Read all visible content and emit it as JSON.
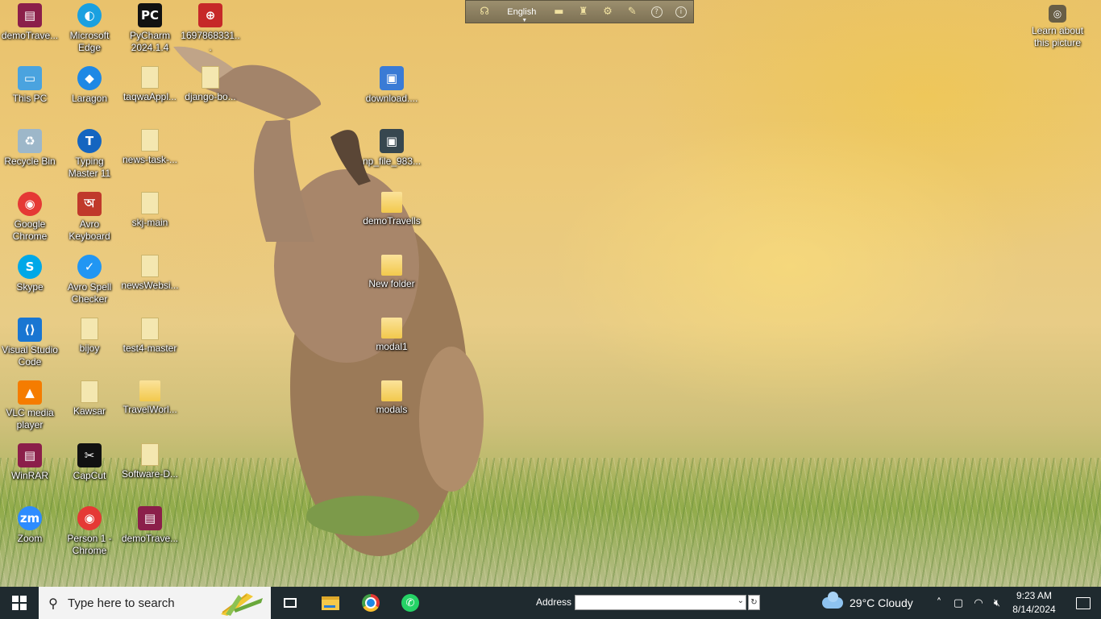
{
  "desktop": {
    "icons": [
      {
        "label": "demoTrave...",
        "icon": "winrar-icon",
        "color": "#8b1f4a"
      },
      {
        "label": "Microsoft Edge",
        "icon": "edge-icon",
        "color": "#1aa0e0"
      },
      {
        "label": "PyCharm 2024.1.4",
        "icon": "pycharm-icon",
        "color": "#111111"
      },
      {
        "label": "1697868331...",
        "icon": "app-icon",
        "color": "#c62828"
      },
      {
        "label": "This PC",
        "icon": "computer-icon",
        "color": "#4aa3df"
      },
      {
        "label": "Laragon",
        "icon": "laragon-icon",
        "color": "#1e88e5"
      },
      {
        "label": "taqwaAppl...",
        "icon": "folder-zip-icon",
        "color": "#f2c94c"
      },
      {
        "label": "django-bo...",
        "icon": "folder-zip-icon",
        "color": "#f2c94c"
      },
      {
        "label": "download....",
        "icon": "image-file-icon",
        "color": "#3a7bd5"
      },
      {
        "label": "Recycle Bin",
        "icon": "recycle-bin-icon",
        "color": "#9db7c9"
      },
      {
        "label": "Typing Master 11",
        "icon": "typing-master-icon",
        "color": "#1565c0"
      },
      {
        "label": "news-task-...",
        "icon": "folder-zip-icon",
        "color": "#f2c94c"
      },
      {
        "label": "np_file_983...",
        "icon": "image-file-icon",
        "color": "#37474f"
      },
      {
        "label": "Google Chrome",
        "icon": "chrome-icon",
        "color": "#e53935"
      },
      {
        "label": "Avro Keyboard",
        "icon": "avro-keyboard-icon",
        "color": "#c0392b"
      },
      {
        "label": "skj-main",
        "icon": "folder-zip-icon",
        "color": "#f2c94c"
      },
      {
        "label": "demoTravells",
        "icon": "folder-icon",
        "color": "#f2c94c"
      },
      {
        "label": "Skype",
        "icon": "skype-icon",
        "color": "#00a8e8"
      },
      {
        "label": "Avro Spell Checker",
        "icon": "spell-checker-icon",
        "color": "#2196f3"
      },
      {
        "label": "newsWebsi...",
        "icon": "folder-zip-icon",
        "color": "#f2c94c"
      },
      {
        "label": "New folder",
        "icon": "folder-icon",
        "color": "#f2c94c"
      },
      {
        "label": "Visual Studio Code",
        "icon": "vscode-icon",
        "color": "#1976d2"
      },
      {
        "label": "bijoy",
        "icon": "folder-zip-icon",
        "color": "#f2c94c"
      },
      {
        "label": "test4-master",
        "icon": "folder-zip-icon",
        "color": "#f2c94c"
      },
      {
        "label": "modal1",
        "icon": "folder-icon",
        "color": "#f2c94c"
      },
      {
        "label": "VLC media player",
        "icon": "vlc-icon",
        "color": "#f57c00"
      },
      {
        "label": "Kawsar",
        "icon": "folder-zip-icon",
        "color": "#f2c94c"
      },
      {
        "label": "TravelWorl...",
        "icon": "folder-icon",
        "color": "#f2c94c"
      },
      {
        "label": "modals",
        "icon": "folder-icon",
        "color": "#f2c94c"
      },
      {
        "label": "WinRAR",
        "icon": "winrar-icon",
        "color": "#8b1f4a"
      },
      {
        "label": "CapCut",
        "icon": "capcut-icon",
        "color": "#111111"
      },
      {
        "label": "Software-D...",
        "icon": "folder-zip-icon",
        "color": "#f2c94c"
      },
      {
        "label": "Zoom",
        "icon": "zoom-icon",
        "color": "#2d8cff"
      },
      {
        "label": "Person 1 - Chrome",
        "icon": "chrome-profile-icon",
        "color": "#e53935"
      },
      {
        "label": "demoTrave...",
        "icon": "winrar-icon",
        "color": "#8b1f4a"
      }
    ]
  },
  "langbar": {
    "language": "English"
  },
  "spotlight": {
    "label": "Learn about this picture"
  },
  "taskbar": {
    "search_placeholder": "Type here to search",
    "address_label": "Address",
    "address_value": "",
    "weather": "29°C  Cloudy",
    "time": "9:23 AM",
    "date": "8/14/2024"
  }
}
